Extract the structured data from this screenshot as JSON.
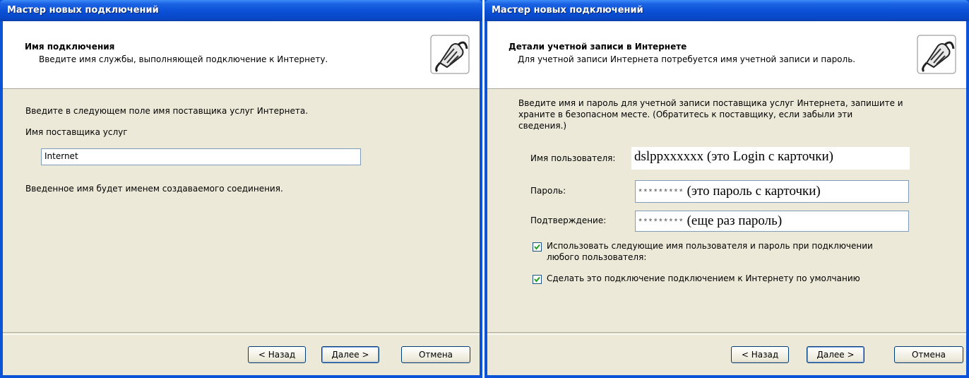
{
  "left": {
    "title": "Мастер новых подключений",
    "header_title": "Имя подключения",
    "header_subtitle": "Введите имя службы, выполняющей подключение к Интернету.",
    "intro": "Введите в следующем поле имя поставщика услуг Интернета.",
    "field_label": "Имя поставщика услуг",
    "field_value": "Internet",
    "note": "Введенное имя будет именем создаваемого соединения.",
    "back_button": "< Назад",
    "next_button": "Далее >",
    "cancel_button": "Отмена"
  },
  "right": {
    "title": "Мастер новых подключений",
    "header_title": "Детали учетной записи в Интернете",
    "header_subtitle": "Для учетной записи Интернета потребуется имя учетной записи и пароль.",
    "intro_line1": "Введите имя и пароль для учетной записи поставщика услуг Интернета, запишите и",
    "intro_line2": "храните в безопасном месте. (Обратитесь к поставщику, если забыли эти",
    "intro_line3": "сведения.)",
    "username_label": "Имя пользователя:",
    "username_value": "dslppxxxxxx (это Login с карточки)",
    "password_label": "Пароль:",
    "password_stars": "*********",
    "password_note": "(это пароль с карточки)",
    "confirm_label": "Подтверждение:",
    "confirm_stars": "*********",
    "confirm_note": "(еще раз пароль)",
    "checkbox1_line1": "Использовать следующие имя пользователя и пароль при подключении",
    "checkbox1_line2": "любого пользователя:",
    "checkbox1_checked": true,
    "checkbox2": "Сделать это подключение подключением к Интернету по умолчанию",
    "checkbox2_checked": true,
    "back_button": "< Назад",
    "next_button": "Далее >",
    "cancel_button": "Отмена"
  },
  "icons": {
    "header_icon": "network-cable-icon",
    "check_icon": "checkmark-icon"
  },
  "colors": {
    "titlebar": "#0a4fd6",
    "client": "#ece9d8",
    "check": "#21a121"
  }
}
